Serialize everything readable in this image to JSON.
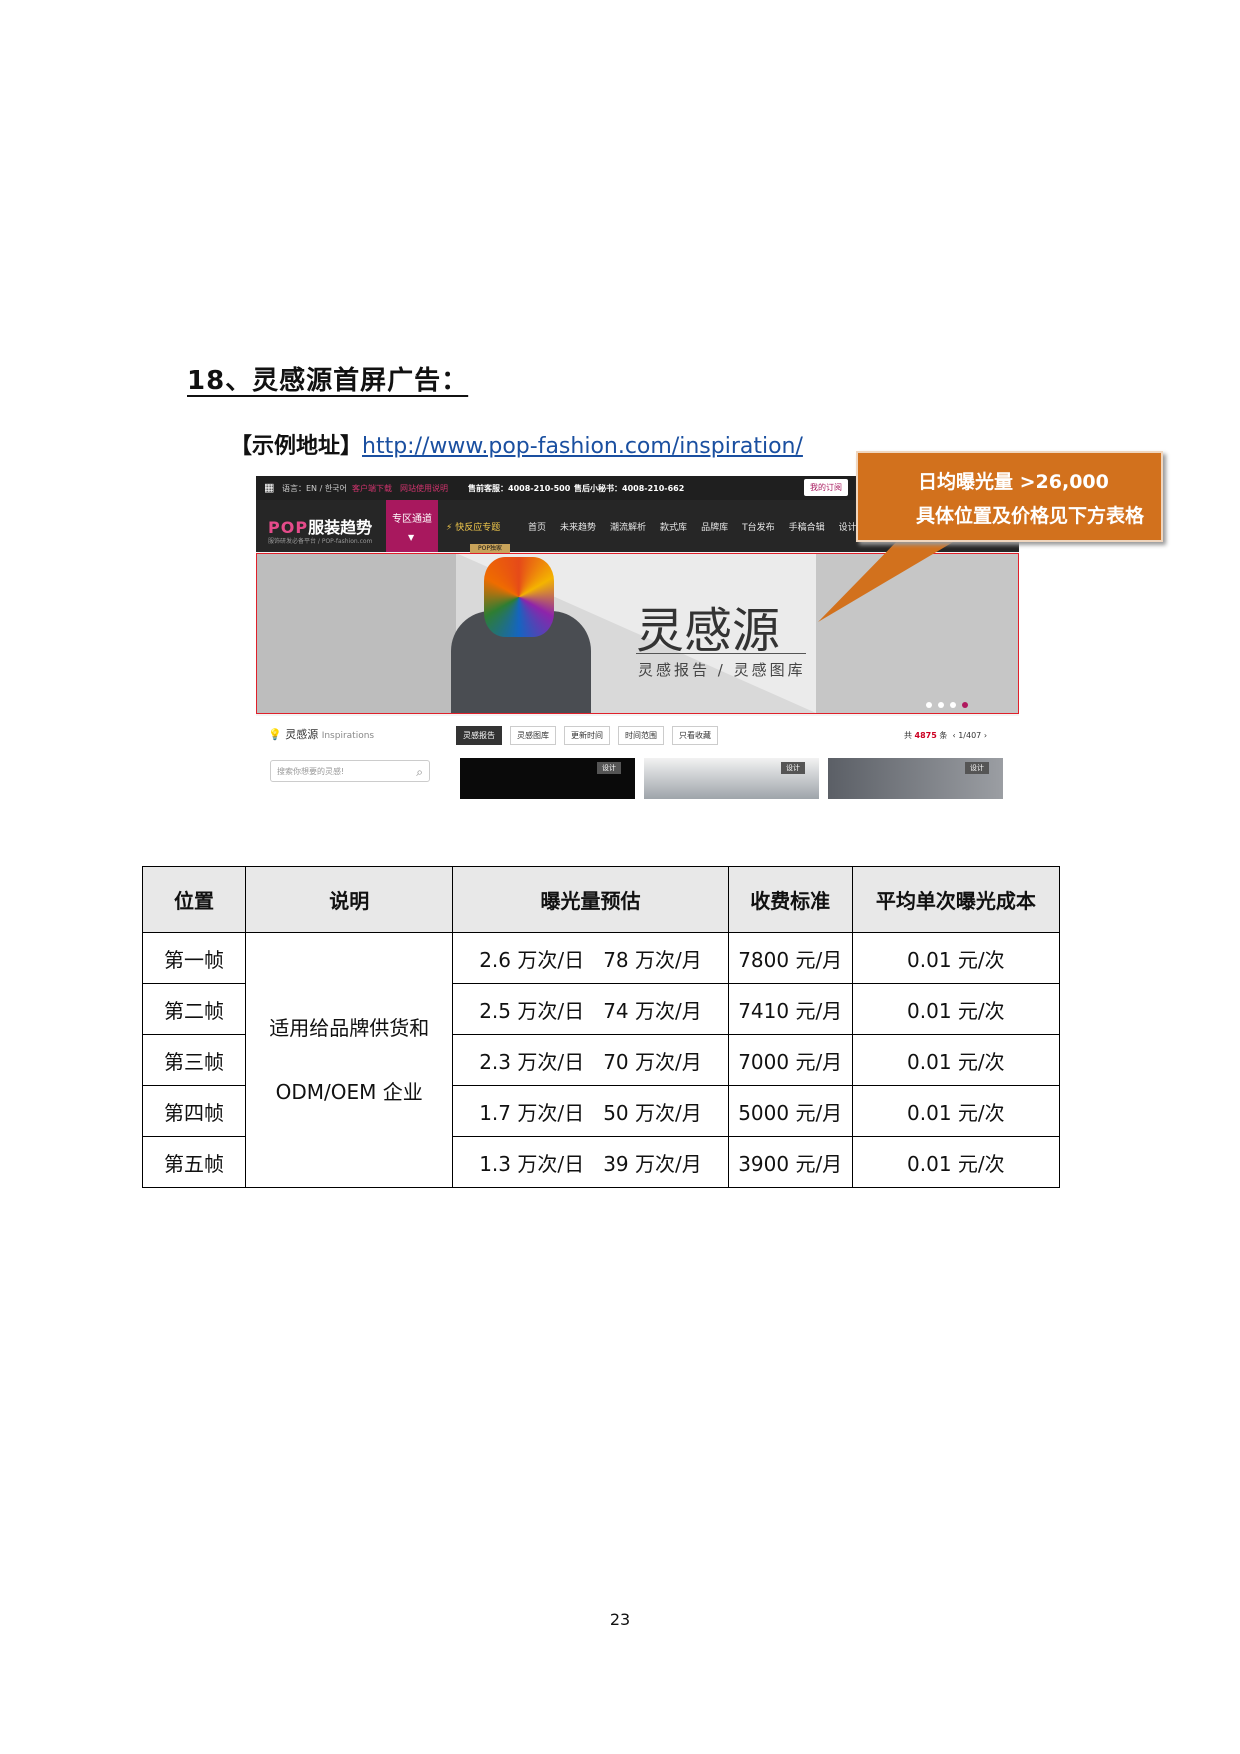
{
  "section": {
    "title": "18、灵感源首屏广告：",
    "example_label": "【示例地址】",
    "example_url": "http://www.pop-fashion.com/inspiration/"
  },
  "screenshot": {
    "topbar": {
      "language": "语言：EN / 한국어",
      "client_download": "客户端下载",
      "guide": "网站使用说明",
      "presale": "售前客服：4008-210-500",
      "aftersale": "售后小秘书：4008-210-662",
      "account": "我的订阅"
    },
    "logo": "服装趋势",
    "logo_sub": "服饰研发必备平台 / POP-fashion.com",
    "nav_special": "专区通道",
    "nav_quick": "快反应专题",
    "nav_pop_tag": "POP独家",
    "nav_links": [
      "首页",
      "未来趋势",
      "潮流解析",
      "款式库",
      "品牌库",
      "T台发布",
      "手稿合辑",
      "设计素材"
    ],
    "banner_title": "灵感源",
    "banner_sub": "灵感报告 / 灵感图库",
    "side_title": "灵感源",
    "side_title_en": "Inspirations",
    "search_placeholder": "搜索你想要的灵感!",
    "tabs": [
      "灵感报告",
      "灵感图库",
      "更新时间",
      "时间范围",
      "只看收藏"
    ],
    "count_prefix": "共",
    "count_value": "4875",
    "count_suffix": "条",
    "pager": "1/407",
    "thumb_tag": "设计"
  },
  "callout": {
    "line1": "日均曝光量  >26,000",
    "line2": "具体位置及价格见下方表格"
  },
  "table": {
    "headers": [
      "位置",
      "说明",
      "曝光量预估",
      "收费标准",
      "平均单次曝光成本"
    ],
    "description_line1": "适用给品牌供货和",
    "description_line2": "ODM/OEM 企业",
    "rows": [
      {
        "position": "第一帧",
        "daily": "2.6 万次/日",
        "monthly": "78 万次/月",
        "price": "7800 元/月",
        "cost": "0.01 元/次"
      },
      {
        "position": "第二帧",
        "daily": "2.5 万次/日",
        "monthly": "74 万次/月",
        "price": "7410 元/月",
        "cost": "0.01 元/次"
      },
      {
        "position": "第三帧",
        "daily": "2.3 万次/日",
        "monthly": "70 万次/月",
        "price": "7000 元/月",
        "cost": "0.01 元/次"
      },
      {
        "position": "第四帧",
        "daily": "1.7 万次/日",
        "monthly": "50 万次/月",
        "price": "5000 元/月",
        "cost": "0.01 元/次"
      },
      {
        "position": "第五帧",
        "daily": "1.3 万次/日",
        "monthly": "39 万次/月",
        "price": "3900 元/月",
        "cost": "0.01 元/次"
      }
    ]
  },
  "page_number": "23"
}
